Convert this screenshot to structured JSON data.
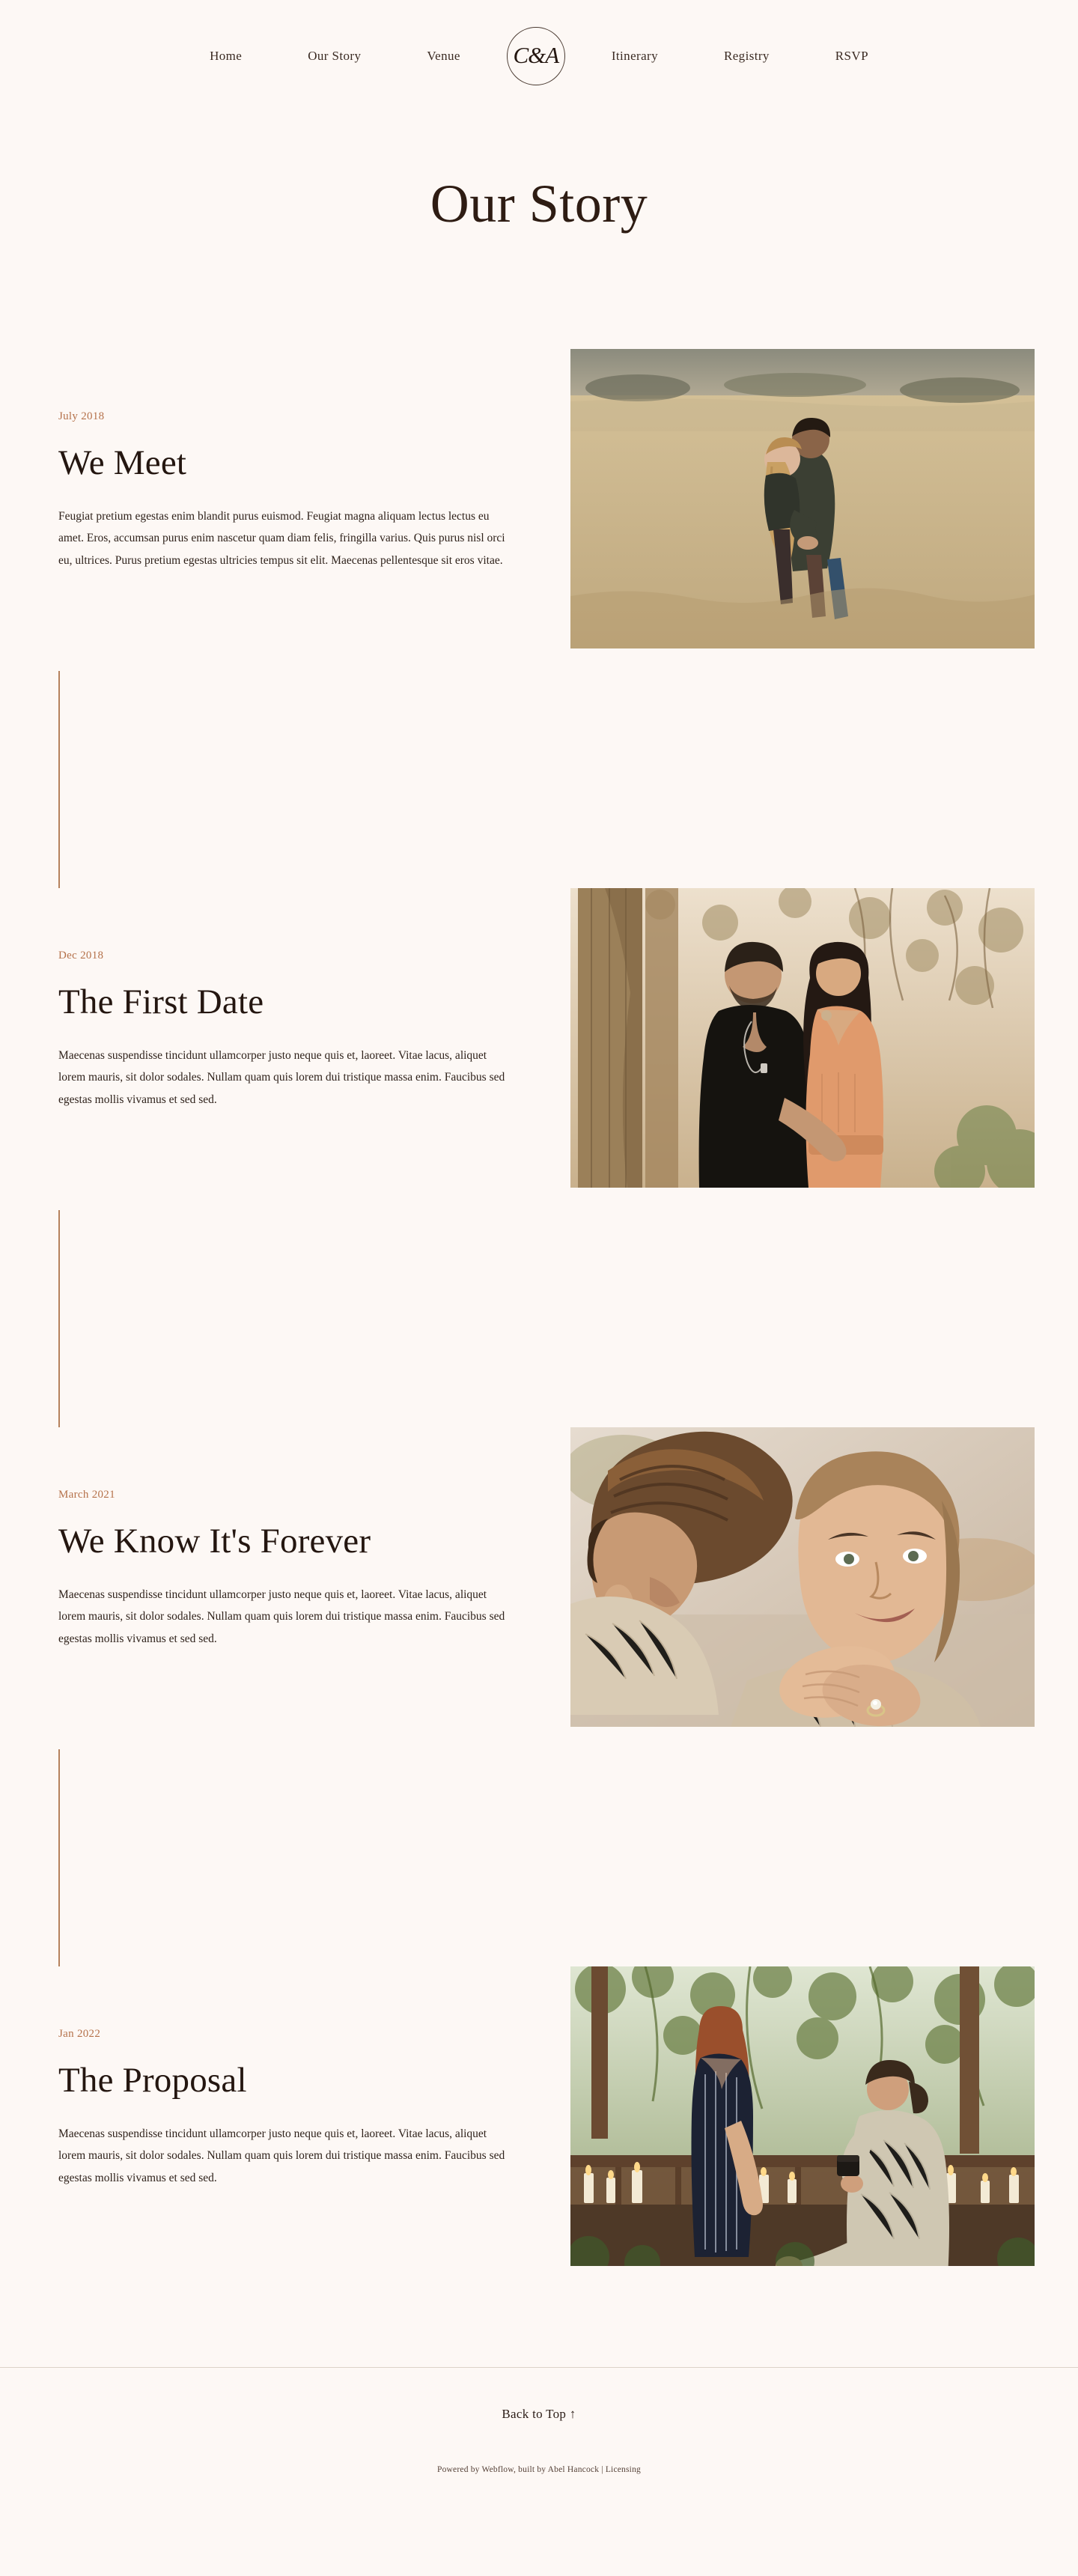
{
  "nav": {
    "left_links": [
      {
        "label": "Home",
        "name": "nav-link-home"
      },
      {
        "label": "Our Story",
        "name": "nav-link-our-story"
      },
      {
        "label": "Venue",
        "name": "nav-link-venue"
      }
    ],
    "logo_monogram": "C&A",
    "right_links": [
      {
        "label": "Itinerary",
        "name": "nav-link-itinerary"
      },
      {
        "label": "Registry",
        "name": "nav-link-registry"
      },
      {
        "label": "RSVP",
        "name": "nav-link-rsvp"
      }
    ]
  },
  "page": {
    "title": "Our Story"
  },
  "stories": [
    {
      "date": "July 2018",
      "heading": "We Meet",
      "body": "Feugiat pretium egestas enim blandit purus euismod. Feugiat magna aliquam lectus lectus eu amet. Eros, accumsan purus enim nascetur quam diam felis, fringilla varius. Quis purus nisl orci eu, ultrices. Purus pretium egestas ultricies tempus sit elit. Maecenas pellentesque sit eros vitae.",
      "photo_alt": "couple-piggyback-golden-field"
    },
    {
      "date": "Dec 2018",
      "heading": "The First Date",
      "body": "Maecenas suspendisse tincidunt ullamcorper justo neque quis et, laoreet. Vitae lacus, aliquet lorem mauris, sit dolor sodales. Nullam quam quis lorem dui tristique massa enim. Faucibus sed egestas mollis vivamus et sed sed.",
      "photo_alt": "couple-forehead-touch-forest"
    },
    {
      "date": "March 2021",
      "heading": "We Know It's Forever",
      "body": "Maecenas suspendisse tincidunt ullamcorper justo neque quis et, laoreet. Vitae lacus, aliquet lorem mauris, sit dolor sodales. Nullam quam quis lorem dui tristique massa enim. Faucibus sed egestas mollis vivamus et sed sed.",
      "photo_alt": "couple-embrace-closeup-ring"
    },
    {
      "date": "Jan 2022",
      "heading": "The Proposal",
      "body": "Maecenas suspendisse tincidunt ullamcorper justo neque quis et, laoreet. Vitae lacus, aliquet lorem mauris, sit dolor sodales. Nullam quam quis lorem dui tristique massa enim. Faucibus sed egestas mollis vivamus et sed sed.",
      "photo_alt": "proposal-candlelit-porch"
    }
  ],
  "footer": {
    "back_to_top": "Back to Top ↑",
    "credit_prefix": "Powered by ",
    "credit_webflow": "Webflow",
    "credit_middle": ", built by ",
    "credit_author": "Abel Hancock",
    "credit_separator": " | ",
    "credit_licensing": "Licensing"
  },
  "colors": {
    "background": "#fdf8f5",
    "accent_date": "#b5714a",
    "timeline_line": "#b5815c",
    "heading": "#241610"
  }
}
